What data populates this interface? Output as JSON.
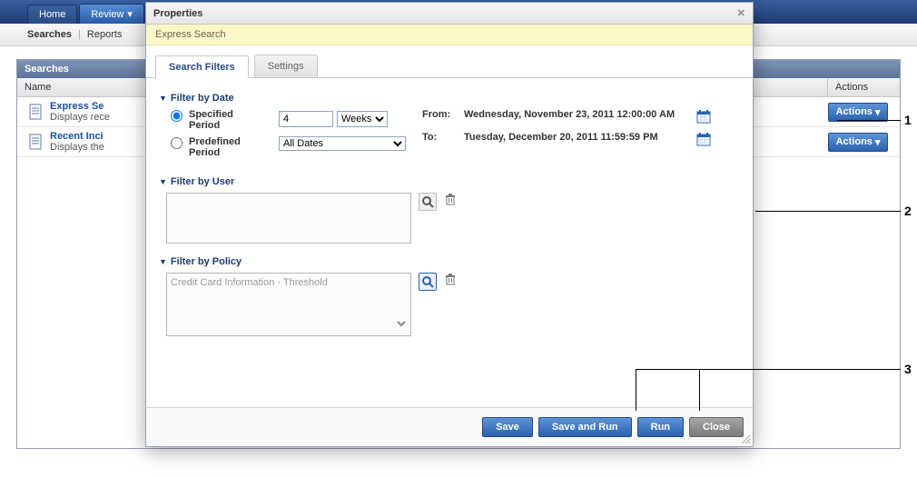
{
  "topnav": {
    "tabs": [
      {
        "label": "Home"
      },
      {
        "label": "Review"
      }
    ]
  },
  "subnav": {
    "item1": "Searches",
    "item2": "Reports"
  },
  "panel": {
    "title": "Searches",
    "columns": {
      "name": "Name",
      "actions": "Actions"
    },
    "rows": [
      {
        "title": "Express Se",
        "desc": "Displays rece"
      },
      {
        "title": "Recent Inci",
        "desc": "Displays the"
      }
    ],
    "actions_label": "Actions"
  },
  "modal": {
    "title": "Properties",
    "subtitle": "Express Search",
    "tabs": {
      "a": "Search Filters",
      "b": "Settings"
    },
    "filter_date": {
      "title": "Filter by Date",
      "specified": "Specified Period",
      "predefined": "Predefined Period",
      "num": "4",
      "unit": "Weeks",
      "predef_value": "All Dates",
      "from_label": "From:",
      "to_label": "To:",
      "from_val": "Wednesday, November 23, 2011 12:00:00 AM",
      "to_val": "Tuesday, December 20, 2011 11:59:59 PM"
    },
    "filter_user": {
      "title": "Filter by User"
    },
    "filter_policy": {
      "title": "Filter by Policy",
      "value": "Credit Card Information - Threshold"
    },
    "buttons": {
      "save": "Save",
      "saverun": "Save and Run",
      "run": "Run",
      "close": "Close"
    }
  },
  "callouts": {
    "c1": "1",
    "c2": "2",
    "c3": "3"
  }
}
